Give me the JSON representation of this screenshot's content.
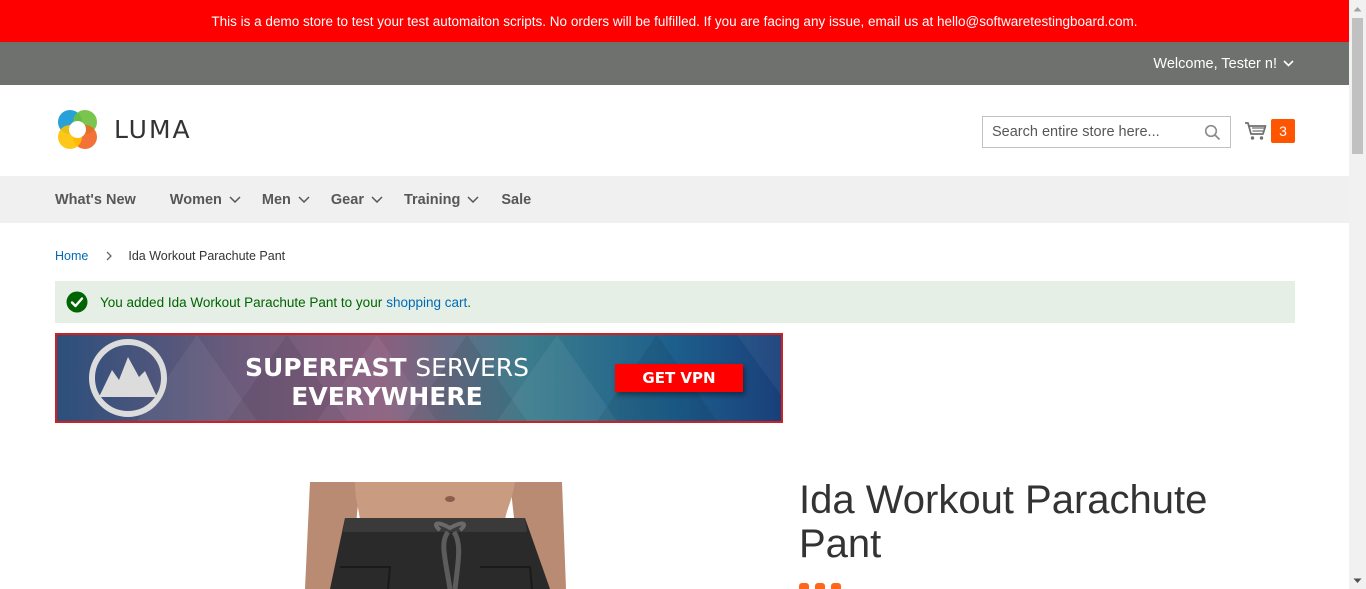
{
  "demo_notice": "This is a demo store to test your test automaiton scripts. No orders will be fulfilled. If you are facing any issue, email us at hello@softwaretestingboard.com.",
  "header": {
    "welcome": "Welcome, Tester n!",
    "logo_text": "LUMA",
    "search_placeholder": "Search entire store here...",
    "cart_count": "3"
  },
  "nav": {
    "items": [
      "What's New",
      "Women",
      "Men",
      "Gear",
      "Training",
      "Sale"
    ]
  },
  "breadcrumb": {
    "home": "Home",
    "current": "Ida Workout Parachute Pant"
  },
  "message": {
    "text": "You added Ida Workout Parachute Pant to your",
    "link": "shopping cart",
    "suffix": "."
  },
  "ad": {
    "headline_bold": "SUPERFAST",
    "headline_light": "SERVERS",
    "headline_line2": "EVERYWHERE",
    "cta": "GET VPN"
  },
  "product": {
    "title": "Ida Workout Parachute Pant"
  },
  "colors": {
    "demo_bar": "#ff0000",
    "panel_header": "#6e716e",
    "nav_bg": "#f0f0f0",
    "link": "#006bb4",
    "cart_badge": "#ff5501",
    "success_bg": "#e5efe5",
    "success_text": "#006400"
  }
}
